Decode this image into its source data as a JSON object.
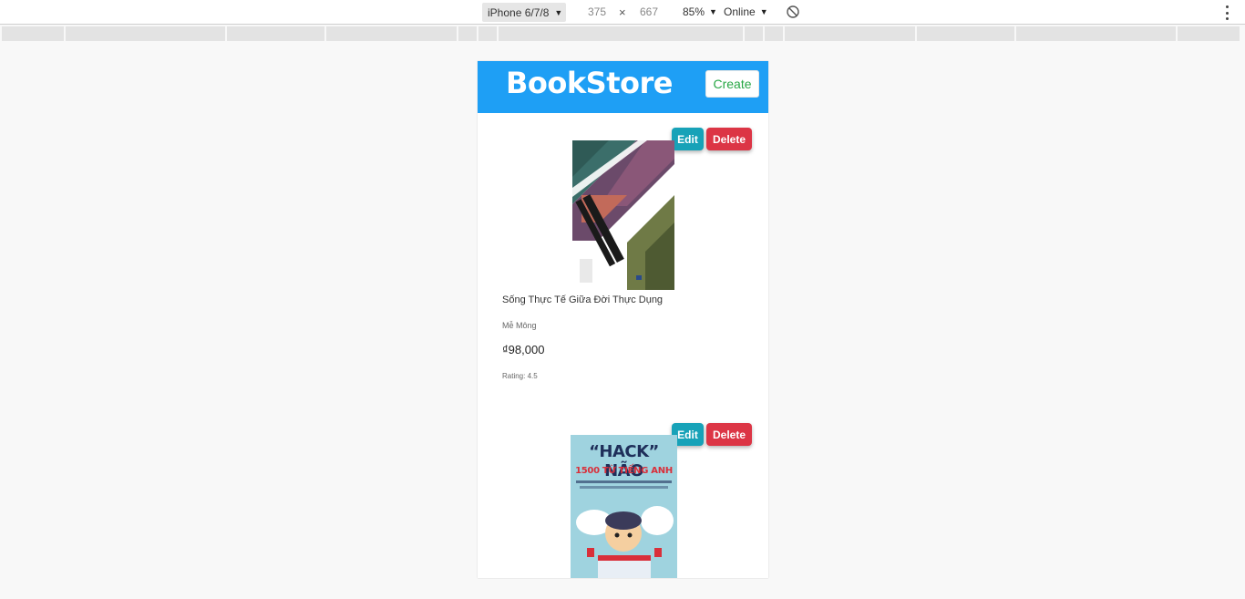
{
  "devtools": {
    "device": "iPhone 6/7/8",
    "width": "375",
    "times": "×",
    "height": "667",
    "zoom": "85%",
    "network": "Online"
  },
  "app": {
    "brand": "BookStore",
    "create_label": "Create"
  },
  "books": [
    {
      "title": "Sống Thực Tế Giữa Đời Thực Dụng",
      "author": "Mễ Mông",
      "price": "₫98,000",
      "rating": "Rating: 4.5",
      "edit_label": "Edit",
      "delete_label": "Delete"
    },
    {
      "cover_line1": "“HACK” NÃO",
      "cover_line2": "1500 TỪ TIẾNG ANH",
      "edit_label": "Edit",
      "delete_label": "Delete"
    }
  ]
}
